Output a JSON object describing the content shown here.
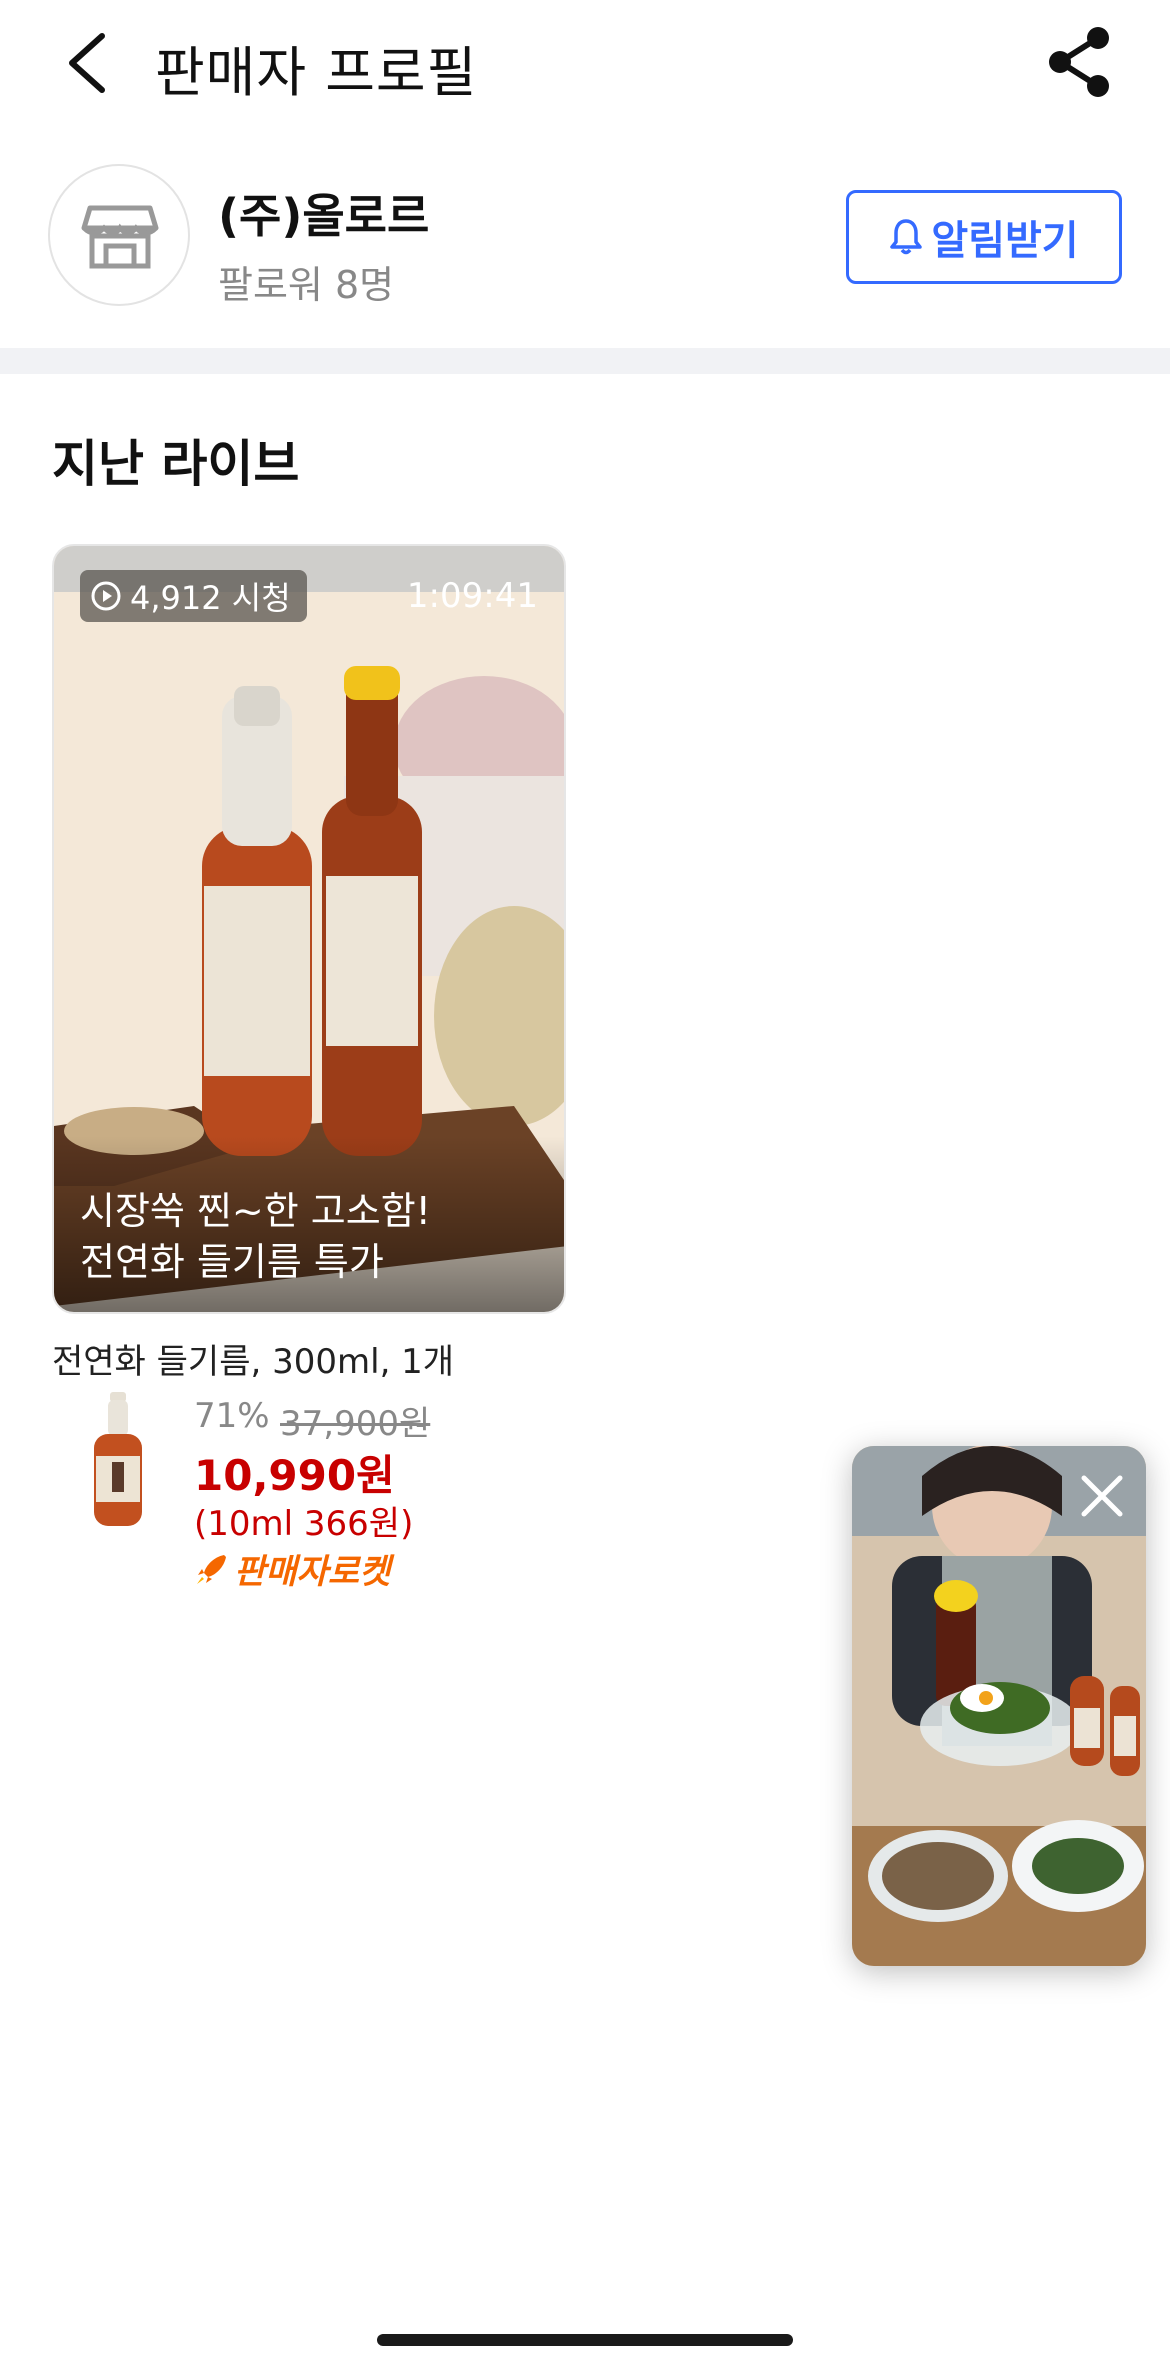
{
  "header": {
    "title": "판매자 프로필"
  },
  "seller": {
    "name": "(주)올로르",
    "followers": "팔로워 8명",
    "notify_label": "알림받기"
  },
  "section": {
    "title": "지난 라이브"
  },
  "live": {
    "views": "4,912 시청",
    "duration": "1:09:41",
    "caption_line1": "시장쑥 찐~한 고소함!",
    "caption_line2": "전연화 들기름 특가"
  },
  "product": {
    "name": "전연화 들기름, 300ml, 1개",
    "discount": "71%",
    "original_price": "37,900원",
    "sale_price": "10,990원",
    "unit_price": "(10ml 366원)",
    "badge": "판매자로켓"
  },
  "colors": {
    "accent": "#346aff",
    "price": "#c80000",
    "rocket": "#f56700"
  }
}
